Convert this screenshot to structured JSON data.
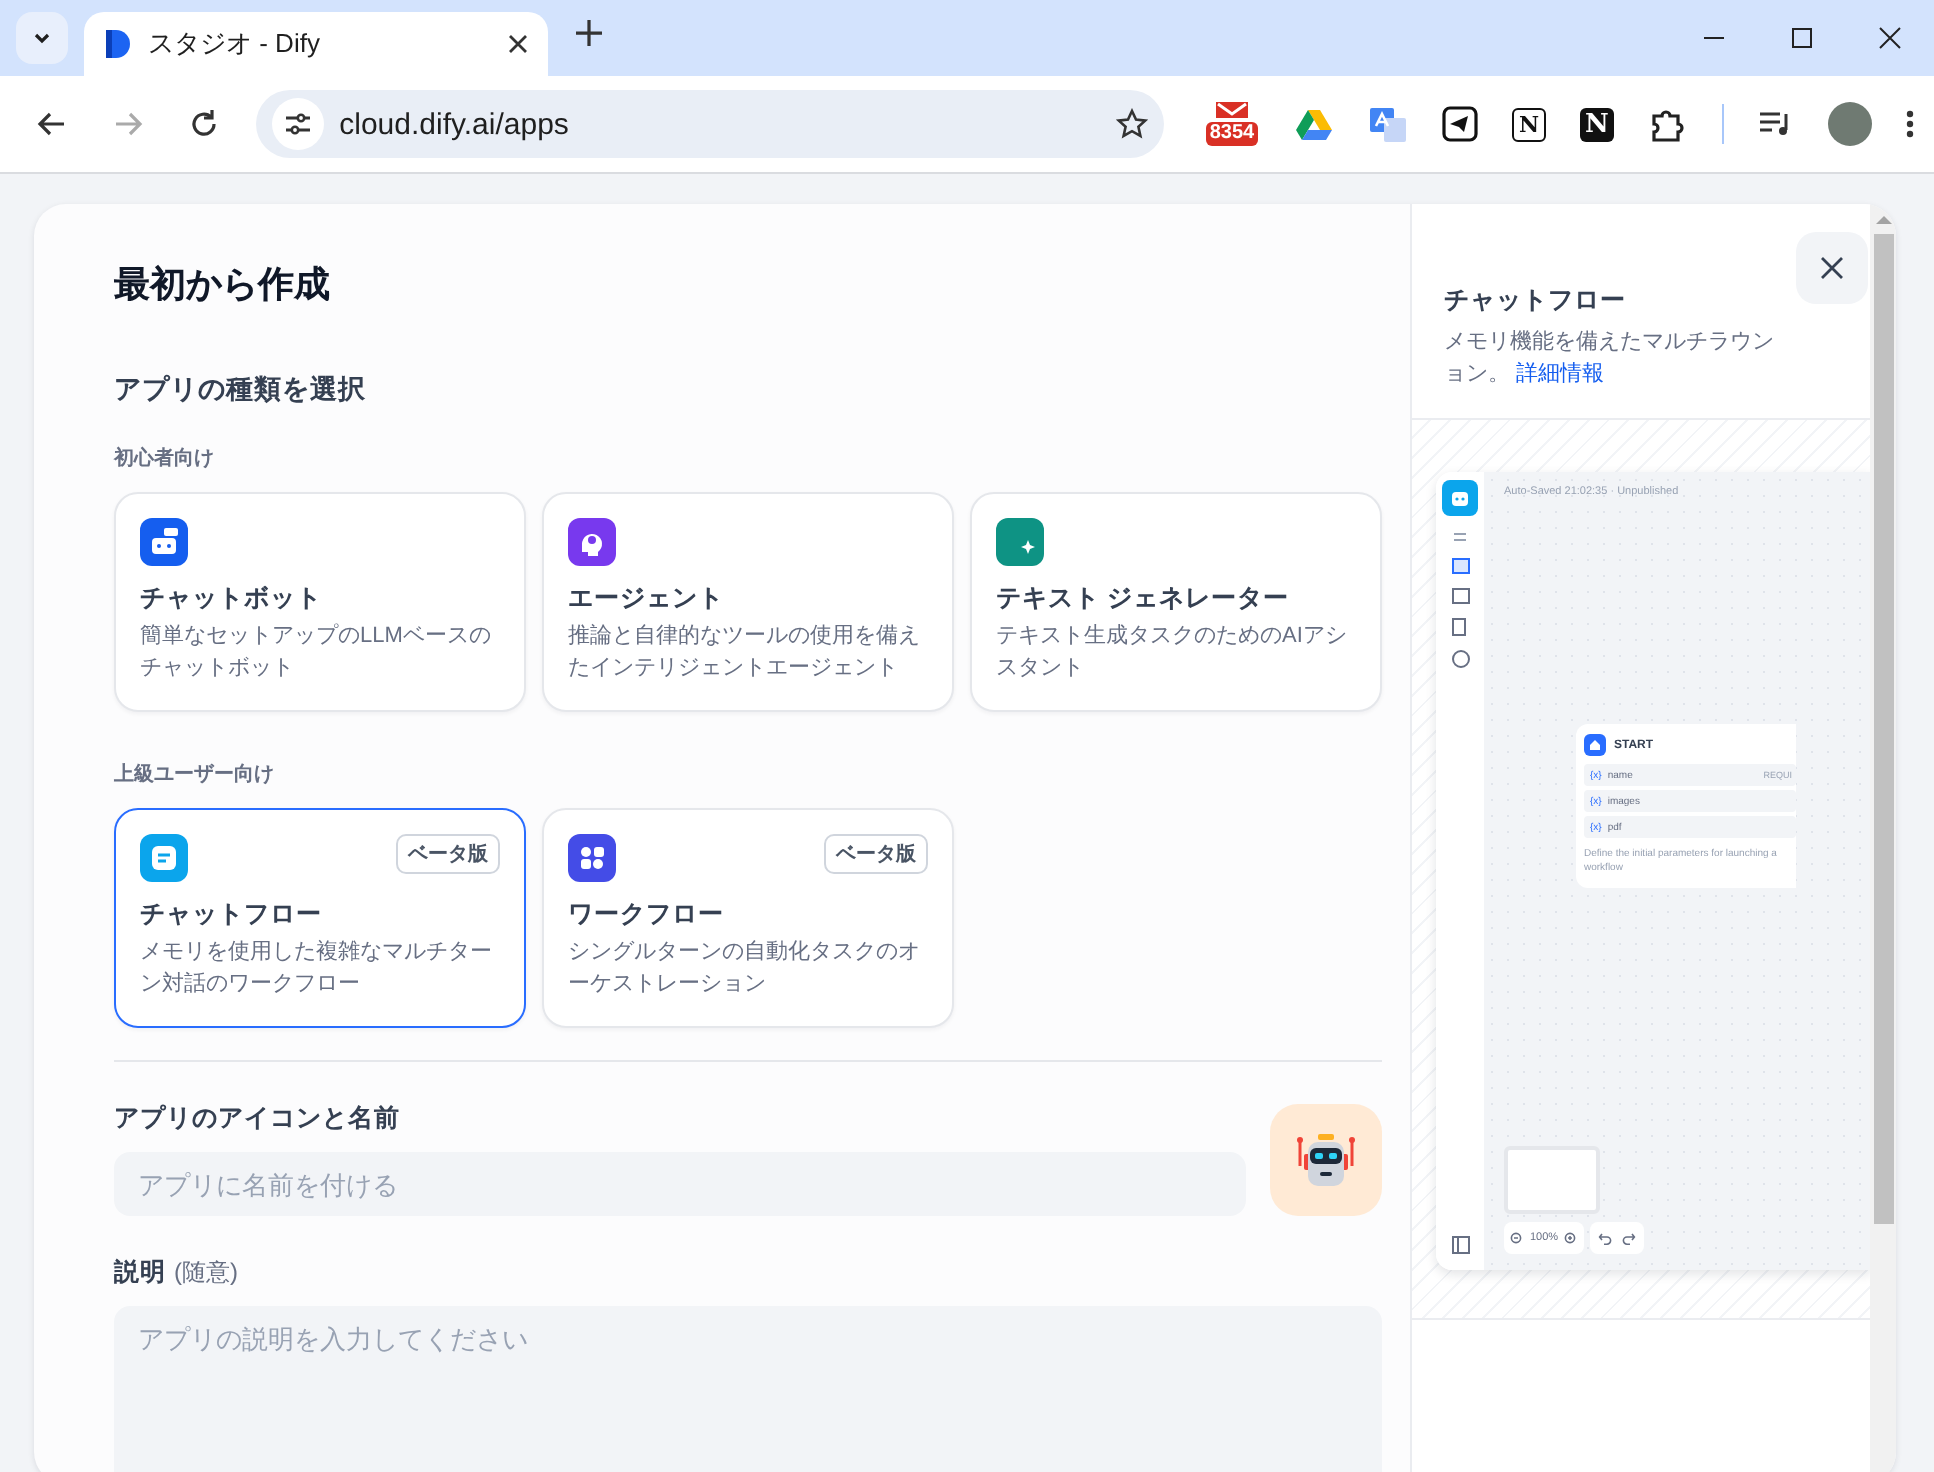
{
  "browser": {
    "tab_title": "スタジオ - Dify",
    "url": "cloud.dify.ai/apps",
    "extensions": [
      {
        "kind": "mail",
        "badge": "8354"
      },
      {
        "kind": "drive"
      },
      {
        "kind": "translate"
      },
      {
        "kind": "plane"
      },
      {
        "kind": "letter-outline",
        "letter": "N"
      },
      {
        "kind": "letter-solid",
        "letter": "N"
      },
      {
        "kind": "puzzle"
      }
    ]
  },
  "dialog": {
    "title": "最初から作成",
    "type_heading": "アプリの種類を選択",
    "groups": [
      {
        "label": "初心者向け",
        "items": [
          {
            "kind": "chatbot",
            "color": "#155eef",
            "name": "チャットボット",
            "description": "簡単なセットアップのLLMベースのチャットボット",
            "selected": false
          },
          {
            "kind": "agent",
            "color": "#7839ee",
            "name": "エージェント",
            "description": "推論と自律的なツールの使用を備えたインテリジェントエージェント",
            "selected": false
          },
          {
            "kind": "completion",
            "color": "#0e9384",
            "name": "テキスト ジェネレーター",
            "description": "テキスト生成タスクのためのAIアシスタント",
            "selected": false
          }
        ]
      },
      {
        "label": "上級ユーザー向け",
        "items": [
          {
            "kind": "chatflow",
            "color": "#0ba5ec",
            "name": "チャットフロー",
            "description": "メモリを使用した複雑なマルチターン対話のワークフロー",
            "badge": "ベータ版",
            "selected": true
          },
          {
            "kind": "workflow",
            "color": "#444ce7",
            "name": "ワークフロー",
            "description": "シングルターンの自動化タスクのオーケストレーション",
            "badge": "ベータ版",
            "selected": false
          }
        ]
      }
    ],
    "name_label": "アプリのアイコンと名前",
    "name_placeholder": "アプリに名前を付ける",
    "description_label": "説明",
    "description_optional": "(随意)",
    "description_placeholder": "アプリの説明を入力してください"
  },
  "preview": {
    "title": "チャットフロー",
    "description_lines": [
      "メモリ機能を備えたマルチラウン",
      "ョン。"
    ],
    "link": "詳細情報",
    "mini_app": {
      "status": "Auto-Saved 21:02:35 · Unpublished",
      "node_title": "START",
      "variables": [
        {
          "marker": "{x}",
          "name": "name",
          "tag": "REQUI"
        },
        {
          "marker": "{x}",
          "name": "images"
        },
        {
          "marker": "{x}",
          "name": "pdf"
        }
      ],
      "node_description": "Define the initial parameters for launching a workflow",
      "zoom": "100%"
    }
  }
}
